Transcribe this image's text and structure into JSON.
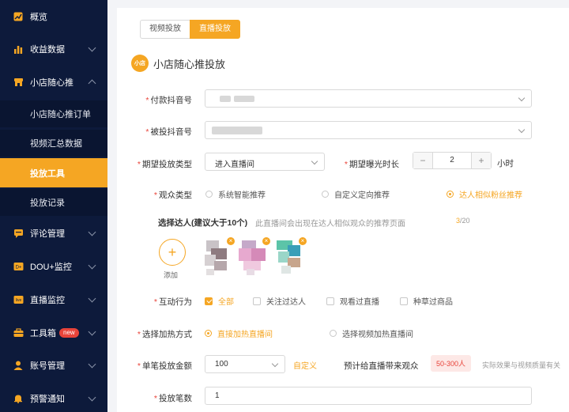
{
  "sidebar": {
    "items": [
      {
        "label": "概览",
        "icon": "chart-square-icon"
      },
      {
        "label": "收益数据",
        "icon": "bar-chart-icon"
      },
      {
        "label": "小店随心推",
        "icon": "store-icon"
      },
      {
        "label": "评论管理",
        "icon": "comment-icon"
      },
      {
        "label": "DOU+监控",
        "icon": "dou-plus-icon"
      },
      {
        "label": "直播监控",
        "icon": "live-icon"
      },
      {
        "label": "工具箱",
        "icon": "toolbox-icon",
        "badge": "new"
      },
      {
        "label": "账号管理",
        "icon": "user-icon"
      },
      {
        "label": "预警通知",
        "icon": "bell-icon"
      }
    ],
    "sub_items": [
      {
        "label": "小店随心推订单"
      },
      {
        "label": "视频汇总数据"
      },
      {
        "label": "投放工具"
      },
      {
        "label": "投放记录"
      }
    ]
  },
  "tabs": [
    {
      "label": "视频投放"
    },
    {
      "label": "直播投放"
    }
  ],
  "page": {
    "logo_text": "小店",
    "title": "小店随心推投放"
  },
  "form": {
    "pay_account_label": "付款抖音号",
    "target_account_label": "被投抖音号",
    "type_label": "期望投放类型",
    "type_value": "进入直播间",
    "duration_label": "期望曝光时长",
    "duration_value": "2",
    "duration_minus": "−",
    "duration_plus": "+",
    "duration_unit": "小时",
    "audience_label": "观众类型",
    "audience_options": [
      "系统智能推荐",
      "自定义定向推荐",
      "达人相似粉丝推荐"
    ],
    "creator_select_label": "选择达人(建议大于10个)",
    "creator_select_hint": "此直播间会出现在达人相似观众的推荐页面",
    "creator_count_current": "3",
    "creator_count_total": "/20",
    "add_label": "添加",
    "add_symbol": "+",
    "remove_symbol": "×",
    "interaction_label": "互动行为",
    "interaction_options": [
      "全部",
      "关注过达人",
      "观看过直播",
      "种草过商品"
    ],
    "heat_label": "选择加热方式",
    "heat_options": [
      "直接加热直播间",
      "选择视频加热直播间"
    ],
    "amount_label": "单笔投放金额",
    "amount_value": "100",
    "amount_custom": "自定义",
    "estimate_label": "预计给直播带来观众",
    "estimate_value": "50-300人",
    "estimate_note": "实际效果与视频质量有关",
    "count_label": "投放笔数",
    "count_value": "1",
    "required_mark": "*"
  },
  "colors": {
    "accent": "#f5a623",
    "sidebar_bg": "#0d1a3b",
    "required": "#e8443a"
  }
}
